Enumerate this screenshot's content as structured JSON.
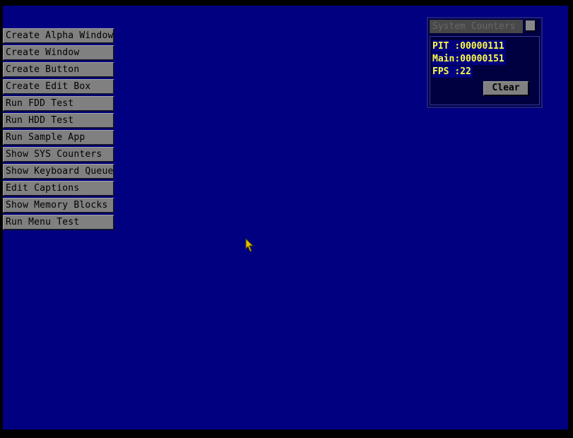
{
  "menu": {
    "items": [
      {
        "label": "Create Alpha Window"
      },
      {
        "label": "Create Window"
      },
      {
        "label": "Create Button"
      },
      {
        "label": "Create Edit Box"
      },
      {
        "label": "Run FDD Test"
      },
      {
        "label": "Run HDD Test"
      },
      {
        "label": "Run Sample App"
      },
      {
        "label": "Show SYS Counters"
      },
      {
        "label": "Show Keyboard Queue"
      },
      {
        "label": "Edit Captions"
      },
      {
        "label": "Show Memory Blocks"
      },
      {
        "label": "Run Menu Test"
      }
    ]
  },
  "counters_window": {
    "title": "System Counters",
    "rows": [
      {
        "label": "PIT ",
        "value": ":00000111"
      },
      {
        "label": "Main",
        "value": ":00000151"
      },
      {
        "label": "FPS ",
        "value": ":22"
      }
    ],
    "clear_label": "Clear"
  },
  "colors": {
    "desktop": "#000080",
    "button_face": "#808080",
    "counter_text": "#ffff40",
    "cursor": "#e0c000"
  }
}
